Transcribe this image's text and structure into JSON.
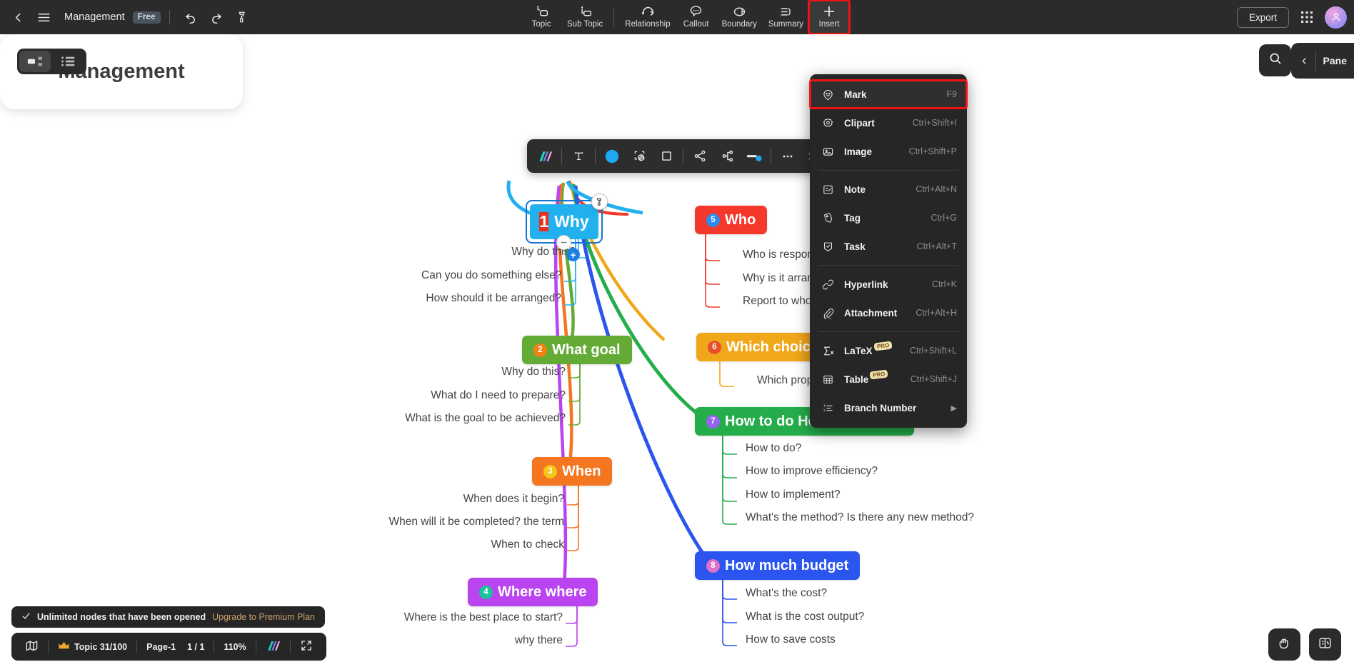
{
  "topbar": {
    "back_icon": "chevron-left-icon",
    "menu_icon": "hamburger-menu-icon",
    "title": "Management",
    "plan_badge": "Free",
    "undo_icon": "undo-icon",
    "redo_icon": "redo-icon",
    "format_painter_icon": "format-painter-icon",
    "tools": [
      {
        "label": "Topic",
        "icon": "topic-icon"
      },
      {
        "label": "Sub Topic",
        "icon": "sub-topic-icon"
      },
      {
        "label": "Relationship",
        "icon": "relationship-icon"
      },
      {
        "label": "Callout",
        "icon": "callout-icon"
      },
      {
        "label": "Boundary",
        "icon": "boundary-icon"
      },
      {
        "label": "Summary",
        "icon": "summary-icon"
      },
      {
        "label": "Insert",
        "icon": "plus-icon"
      }
    ],
    "export_label": "Export",
    "apps_icon": "apps-grid-icon",
    "avatar_icon": "user-avatar-icon"
  },
  "insert_menu": {
    "items": [
      {
        "label": "Mark",
        "shortcut": "F9",
        "icon": "smiley-mark-icon",
        "pro": false,
        "highlighted": true
      },
      {
        "label": "Clipart",
        "shortcut": "Ctrl+Shift+I",
        "icon": "clipart-icon",
        "pro": false
      },
      {
        "label": "Image",
        "shortcut": "Ctrl+Shift+P",
        "icon": "image-icon",
        "pro": false
      },
      {
        "label": "Note",
        "shortcut": "Ctrl+Alt+N",
        "icon": "note-icon",
        "pro": false
      },
      {
        "label": "Tag",
        "shortcut": "Ctrl+G",
        "icon": "tag-icon",
        "pro": false
      },
      {
        "label": "Task",
        "shortcut": "Ctrl+Alt+T",
        "icon": "task-icon",
        "pro": false
      },
      {
        "label": "Hyperlink",
        "shortcut": "Ctrl+K",
        "icon": "link-icon",
        "pro": false
      },
      {
        "label": "Attachment",
        "shortcut": "Ctrl+Alt+H",
        "icon": "paperclip-icon",
        "pro": false
      },
      {
        "label": "LaTeX",
        "shortcut": "Ctrl+Shift+L",
        "icon": "sigma-icon",
        "pro": true,
        "pro_label": "PRO"
      },
      {
        "label": "Table",
        "shortcut": "Ctrl+Shift+J",
        "icon": "table-icon",
        "pro": true,
        "pro_label": "PRO"
      },
      {
        "label": "Branch Number",
        "shortcut": "",
        "icon": "numbered-list-icon",
        "pro": false,
        "submenu": true
      }
    ],
    "highlight_color": "#f11414"
  },
  "format_toolbar": {
    "buttons": [
      {
        "icon": "style-gradient-icon"
      },
      {
        "icon": "text-format-icon"
      },
      {
        "icon": "fill-color-icon"
      },
      {
        "icon": "shape-border-icon"
      },
      {
        "icon": "shape-square-icon"
      },
      {
        "icon": "branch-layout-icon"
      },
      {
        "icon": "structure-icon"
      },
      {
        "icon": "line-style-icon"
      },
      {
        "icon": "more-options-icon"
      }
    ],
    "close_icon": "close-icon"
  },
  "view_toggle": {
    "mindmap_icon": "mindmap-view-icon",
    "outline_icon": "outline-view-icon",
    "selected": "mindmap"
  },
  "search": {
    "icon": "search-icon"
  },
  "right_panel": {
    "collapse_icon": "chevron-left-icon",
    "label": "Pane"
  },
  "mindmap": {
    "root": {
      "label": "Management"
    },
    "branches": [
      {
        "number": "1",
        "label": "Why",
        "color": "#23b0ee",
        "badge_color": "#e8301c",
        "side": "left",
        "selected": true,
        "children": [
          "Why do this?",
          "Can you do something else?",
          "How should it be arranged?"
        ]
      },
      {
        "number": "2",
        "label": "What goal",
        "color": "#64ab36",
        "badge_color": "#f08214",
        "side": "left",
        "children": [
          "Why do this?",
          "What do I need to prepare?",
          "What is the goal to be achieved?"
        ]
      },
      {
        "number": "3",
        "label": "When",
        "color": "#f47620",
        "badge_color": "#f5c518",
        "side": "left",
        "children": [
          "When does it begin?",
          "When will it be completed? the term",
          "When to check"
        ]
      },
      {
        "number": "4",
        "label": "Where where",
        "color": "#b944f0",
        "badge_color": "#19c39c",
        "side": "left",
        "children": [
          "Where is the best place to start?",
          "why there"
        ]
      },
      {
        "number": "5",
        "label": "Who",
        "color": "#f4382b",
        "badge_color": "#2a8cf0",
        "side": "right",
        "children": [
          "Who is responsible?",
          "Why is it arranged?",
          "Report to who?"
        ]
      },
      {
        "number": "6",
        "label": "Which choice",
        "color": "#f0a71a",
        "badge_color": "#e8502a",
        "side": "right",
        "children": [
          "Which proposal?"
        ]
      },
      {
        "number": "7",
        "label": "How to do How to execute",
        "color": "#25ad4b",
        "badge_color": "#9763f0",
        "side": "right",
        "children": [
          "How to do?",
          "How to improve efficiency?",
          "How to implement?",
          "What's the method? Is there any new method?"
        ]
      },
      {
        "number": "8",
        "label": "How much budget",
        "color": "#2b55ee",
        "badge_color": "#e070c8",
        "side": "right",
        "children": [
          "What's the cost?",
          "What is the cost output?",
          "How to save costs"
        ]
      }
    ]
  },
  "toast": {
    "check_icon": "check-icon",
    "message": "Unlimited nodes that have been opened",
    "cta": "Upgrade to Premium Plan"
  },
  "statusbar": {
    "map_icon": "map-icon",
    "crown_icon": "crown-icon",
    "topic_count": "Topic 31/100",
    "page_label": "Page-1",
    "page_nav": "1 / 1",
    "zoom": "110%",
    "theme_icon": "theme-gradient-icon",
    "fullscreen_icon": "fullscreen-icon"
  },
  "fabs": [
    {
      "icon": "hand-tool-icon"
    },
    {
      "icon": "ai-assistant-icon"
    }
  ]
}
